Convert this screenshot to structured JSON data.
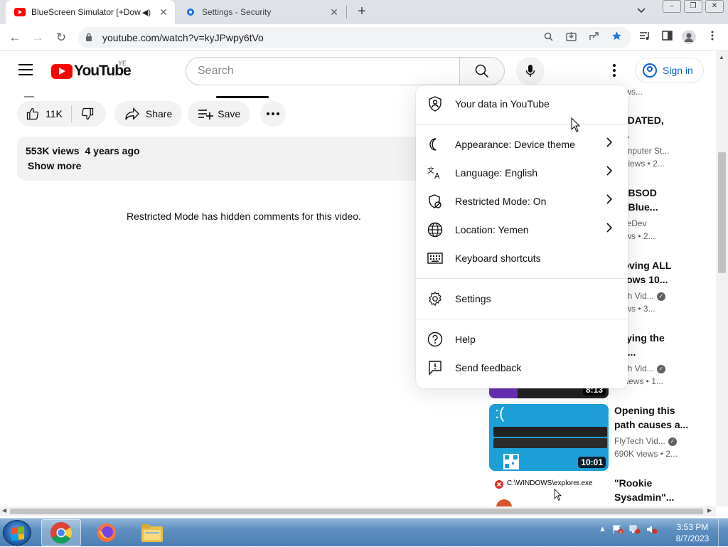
{
  "browser": {
    "tabs": [
      {
        "title": "BlueScreen Simulator [+Dow",
        "active": true
      },
      {
        "title": "Settings - Security",
        "active": false
      }
    ],
    "new_tab": "+",
    "url": "youtube.com/watch?v=kyJPwpy6tVo"
  },
  "youtube": {
    "logo_text": "YouTube",
    "country_code": "YE",
    "search_placeholder": "Search",
    "sign_in": "Sign in"
  },
  "video": {
    "likes": "11K",
    "share_label": "Share",
    "save_label": "Save",
    "views": "553K views",
    "age": "4 years ago",
    "show_more": "Show more",
    "restricted_message": "Restricted Mode has hidden comments for this video."
  },
  "menu": {
    "items": [
      {
        "label": "Your data in YouTube",
        "icon": "shield-person-icon",
        "chevron": false
      },
      {
        "label": "Appearance: Device theme",
        "icon": "moon-icon",
        "chevron": true
      },
      {
        "label": "Language: English",
        "icon": "translate-icon",
        "chevron": true
      },
      {
        "label": "Restricted Mode: On",
        "icon": "restricted-icon",
        "chevron": true
      },
      {
        "label": "Location: Yemen",
        "icon": "globe-icon",
        "chevron": true
      },
      {
        "label": "Keyboard shortcuts",
        "icon": "keyboard-icon",
        "chevron": false
      },
      {
        "label": "Settings",
        "icon": "gear-icon",
        "chevron": false
      },
      {
        "label": "Help",
        "icon": "help-icon",
        "chevron": false
      },
      {
        "label": "Send feedback",
        "icon": "feedback-icon",
        "chevron": false
      }
    ]
  },
  "recommendations": [
    {
      "title2": "views..."
    },
    {
      "title1": "UTDATED,",
      "title2": "E...",
      "channel": "Computer St...",
      "stats": "M views  • 2..."
    },
    {
      "title1": "ke BSOD",
      "title2": "ke Blue...",
      "channel": "TreeDev",
      "stats": "views  • 2..."
    },
    {
      "title1": "moving ALL",
      "title2": "ndows 10...",
      "channel": "Tech Vid...",
      "stats": "views  • 3..."
    },
    {
      "title1": "difying the",
      "title2": "AL...",
      "channel": "Tech Vid...",
      "stats": "K views  • 1...",
      "duration": "8:13"
    },
    {
      "title1": "Opening this",
      "title2": "path causes a...",
      "channel": "FlyTech Vid...",
      "stats": "690K views  • 2...",
      "duration": "10:01"
    },
    {
      "title1": "\"Rookie",
      "title2": "Sysadmin\"..."
    }
  ],
  "thumbnail_text": {
    "explorer": "C:\\WINDOWS\\explorer.exe",
    "bsod_face": ":("
  },
  "taskbar": {
    "time": "3:53 PM",
    "date": "8/7/2023"
  },
  "colors": {
    "yt_red": "#ff0000",
    "link_blue": "#065fd4",
    "bsod_blue": "#1d9fd8"
  }
}
